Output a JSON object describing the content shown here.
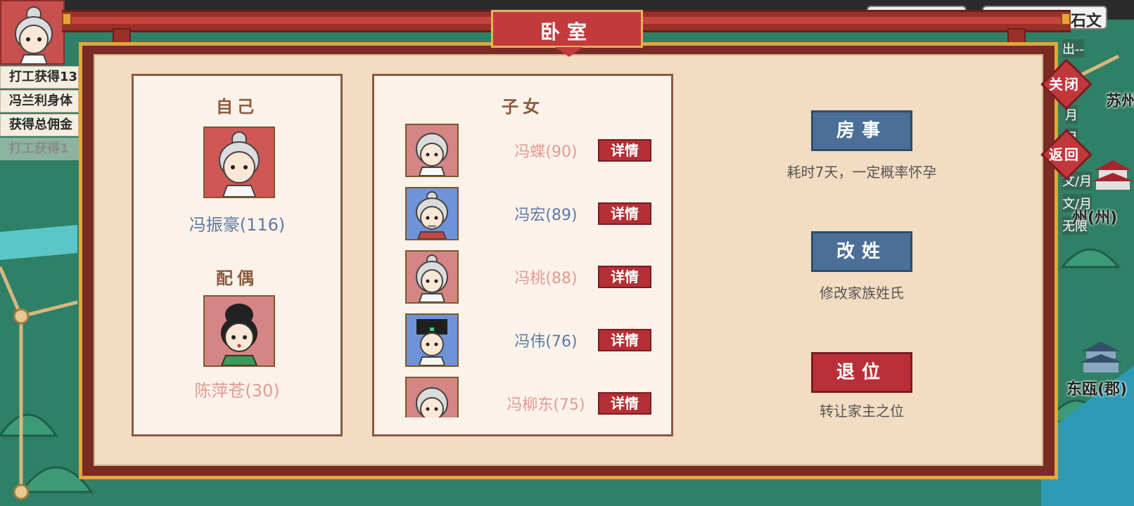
{
  "top_right_text": "石文",
  "log": [
    "打工获得13",
    "冯兰利身体",
    "获得总佣金",
    "打工获得1"
  ],
  "map_labels": {
    "suzhou": "苏州",
    "zhou": "州(州)",
    "dongou": "东瓯(郡)",
    "side_tags": [
      "出--",
      "月",
      "月",
      "文/月",
      "文/月",
      "无限"
    ]
  },
  "dialog": {
    "title": "卧室",
    "self_section": {
      "title": "自己",
      "name": "冯振豪(116)",
      "spouse_title": "配偶",
      "spouse_name": "陈萍苍(30)"
    },
    "children_section": {
      "title": "子女",
      "detail_label": "详情",
      "children": [
        {
          "name": "冯蝶(90)",
          "gender": "female"
        },
        {
          "name": "冯宏(89)",
          "gender": "male"
        },
        {
          "name": "冯桃(88)",
          "gender": "female"
        },
        {
          "name": "冯伟(76)",
          "gender": "male"
        },
        {
          "name": "冯柳东(75)",
          "gender": "female"
        }
      ]
    },
    "actions": [
      {
        "label": "房事",
        "desc": "耗时7天，一定概率怀孕",
        "style": "blue"
      },
      {
        "label": "改姓",
        "desc": "修改家族姓氏",
        "style": "blue"
      },
      {
        "label": "退位",
        "desc": "转让家主之位",
        "style": "red"
      }
    ],
    "close_label": "关闭",
    "back_label": "返回"
  },
  "colors": {
    "accent_red": "#b42f36",
    "male_name": "#5c7aa6",
    "female_name": "#e29b92",
    "panel_bg": "#fbf2ea"
  }
}
